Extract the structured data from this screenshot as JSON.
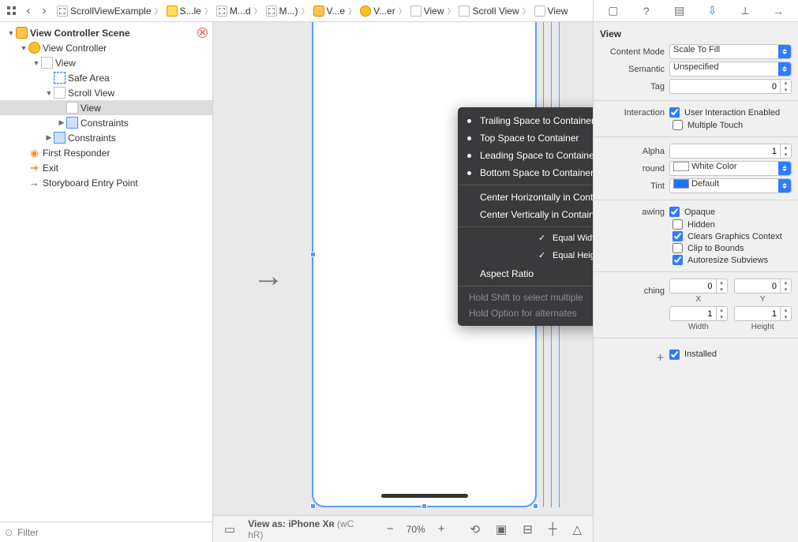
{
  "topbar": {
    "crumbs": [
      {
        "icon": "storyboard",
        "label": "ScrollViewExample"
      },
      {
        "icon": "folder",
        "label": "S...le"
      },
      {
        "icon": "storyboard",
        "label": "M...d"
      },
      {
        "icon": "storyboard",
        "label": "M...)"
      },
      {
        "icon": "scene",
        "label": "V...e"
      },
      {
        "icon": "vcicon",
        "label": "V...er"
      },
      {
        "icon": "view",
        "label": "View"
      },
      {
        "icon": "view",
        "label": "Scroll View"
      },
      {
        "icon": "view",
        "label": "View"
      }
    ]
  },
  "outline": {
    "scene_title": "View Controller Scene",
    "vc": "View Controller",
    "view": "View",
    "safearea": "Safe Area",
    "scrollview": "Scroll View",
    "innerview": "View",
    "constraints": "Constraints",
    "constraints2": "Constraints",
    "first_responder": "First Responder",
    "exit": "Exit",
    "entry": "Storyboard Entry Point",
    "filter_placeholder": "Filter"
  },
  "popup": {
    "trailing": "Trailing Space to Container",
    "top": "Top Space to Container",
    "leading": "Leading Space to Container",
    "bottom": "Bottom Space to Container",
    "centerH": "Center Horizontally in Container",
    "centerV": "Center Vertically in Container",
    "equalW": "Equal Widths",
    "equalH": "Equal Heights",
    "aspect": "Aspect Ratio",
    "hint1": "Hold Shift to select multiple",
    "hint2": "Hold Option for alternates"
  },
  "canvasbar": {
    "viewas": "View as: iPhone Xʀ",
    "traits": "(wC hR)",
    "zoom": "70%"
  },
  "inspector": {
    "title": "View",
    "contentMode_label": "Content Mode",
    "contentMode": "Scale To Fill",
    "semantic_label": "Semantic",
    "semantic": "Unspecified",
    "tag_label": "Tag",
    "tag": "0",
    "interaction_label": "Interaction",
    "uie": "User Interaction Enabled",
    "mt": "Multiple Touch",
    "alpha_label": "Alpha",
    "alpha": "1",
    "background_label": "round",
    "background": "White Color",
    "tint_label": "Tint",
    "tint": "Default",
    "drawing_label": "awing",
    "opaque": "Opaque",
    "hidden": "Hidden",
    "clearsGC": "Clears Graphics Context",
    "clip": "Clip to Bounds",
    "autoresize": "Autoresize Subviews",
    "stretch_label": "ching",
    "x": "0",
    "y": "0",
    "x_cap": "X",
    "y_cap": "Y",
    "w": "1",
    "h": "1",
    "w_cap": "Width",
    "h_cap": "Height",
    "installed": "Installed"
  }
}
